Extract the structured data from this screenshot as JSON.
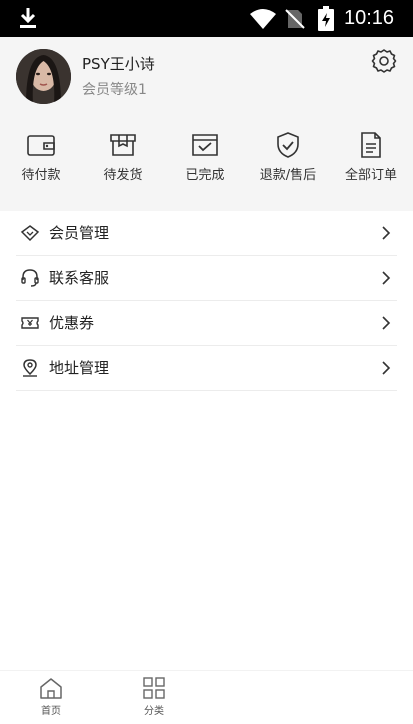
{
  "status_bar": {
    "time": "10:16",
    "icons": [
      "download-icon",
      "wifi-icon",
      "no-sim-icon",
      "battery-charging-icon"
    ]
  },
  "profile": {
    "name": "PSY王小诗",
    "level": "会员等级1",
    "settings_icon": "gear-icon"
  },
  "orders": [
    {
      "label": "待付款",
      "icon": "wallet-icon"
    },
    {
      "label": "待发货",
      "icon": "package-icon"
    },
    {
      "label": "已完成",
      "icon": "completed-box-icon"
    },
    {
      "label": "退款/售后",
      "icon": "shield-check-icon"
    },
    {
      "label": "全部订单",
      "icon": "document-icon"
    }
  ],
  "menu": [
    {
      "label": "会员管理",
      "icon": "diamond-icon"
    },
    {
      "label": "联系客服",
      "icon": "headset-icon"
    },
    {
      "label": "优惠券",
      "icon": "coupon-icon"
    },
    {
      "label": "地址管理",
      "icon": "location-icon"
    }
  ],
  "bottom_nav": [
    {
      "label": "首页",
      "icon": "home-icon"
    },
    {
      "label": "分类",
      "icon": "grid-icon"
    }
  ],
  "colors": {
    "status_bar": "#000000",
    "header_bg": "#f5f5f5",
    "text_primary": "#222222",
    "text_secondary": "#888888"
  }
}
